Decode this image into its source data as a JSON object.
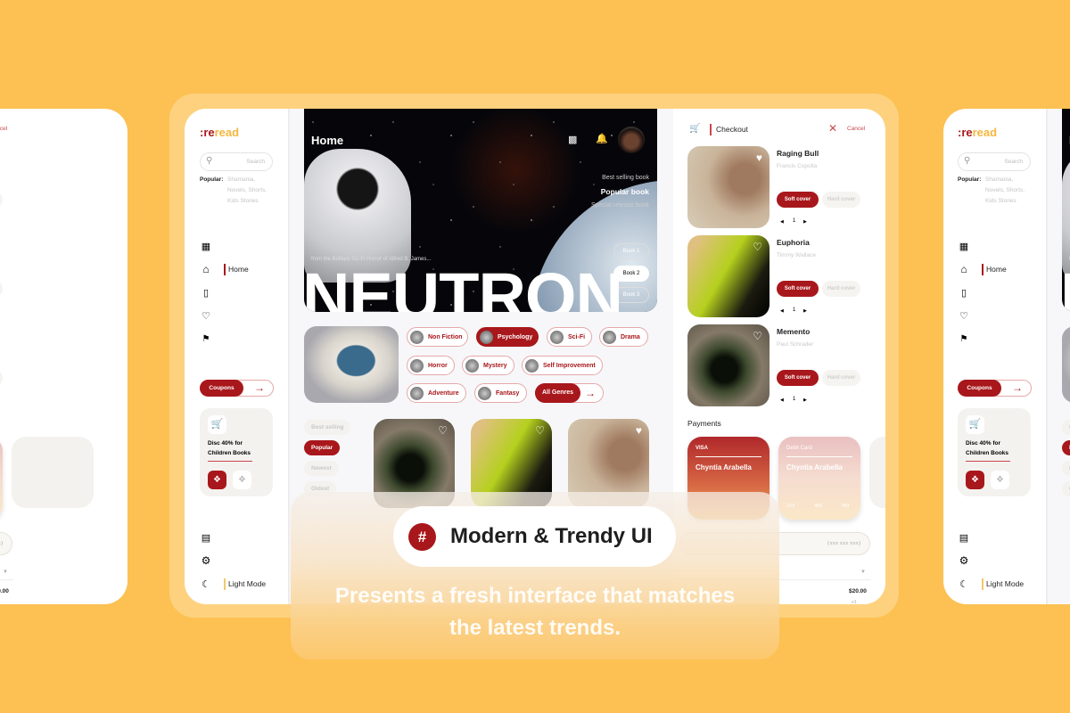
{
  "sidebar": {
    "logo_a": ":re",
    "logo_b": "read",
    "search_placeholder": "Search",
    "popular_label": "Popular:",
    "popular_items": [
      "Shamania,",
      "Novels, Shorts,",
      "Kids Stories"
    ],
    "nav": [
      {
        "icon": "grid-icon"
      },
      {
        "icon": "home-icon",
        "label": "Home",
        "active": true
      },
      {
        "icon": "book-icon"
      },
      {
        "icon": "heart-icon"
      },
      {
        "icon": "bookmark-icon"
      }
    ],
    "coupons_label": "Coupons",
    "promo": {
      "line1": "Disc 40% for",
      "line2": "Children Books"
    },
    "bottom": {
      "mode_label": "Light Mode"
    }
  },
  "hero": {
    "title": "Home",
    "tags": [
      "Best selling book",
      "Popular book",
      "Special release book"
    ],
    "books": [
      "Book 1",
      "Book 2",
      "Book 3"
    ],
    "selected_book": "Book 2",
    "tagline": "from the Brilliant Sci-Fi Horror of Alfred B. James...",
    "book_title": "NEUTRON"
  },
  "genres": {
    "items": [
      "Non Fiction",
      "Psychology",
      "Sci-Fi",
      "Drama",
      "Horror",
      "Mystery",
      "Self Improvement",
      "Adventure",
      "Fantasy"
    ],
    "selected": "Psychology",
    "all_label": "All Genres"
  },
  "sort": {
    "items": [
      "Best selling",
      "Popular",
      "Newest",
      "Oldest"
    ],
    "selected": "Popular"
  },
  "checkout": {
    "title": "Checkout",
    "cancel": "Cancel",
    "items": [
      {
        "title": "Raging Bull",
        "author": "Francis Copolla",
        "qty": "1"
      },
      {
        "title": "Euphoria",
        "author": "Timmy Wallace",
        "qty": "1"
      },
      {
        "title": "Memento",
        "author": "Paul Schrader",
        "qty": "1"
      }
    ],
    "soft_label": "Soft cover",
    "hard_label": "Hard cover",
    "payments_label": "Payments",
    "cards": [
      {
        "type": "VISA",
        "name": "Chyntia Arabella"
      },
      {
        "type": "Debit Card",
        "name": "Chyntia Arabella",
        "number": [
          "123",
          "456",
          "789"
        ]
      }
    ],
    "phone_placeholder": "(xxx xxx xxx)",
    "price": "$20.00",
    "qty_label": "x1",
    "partial_label": "ry"
  },
  "banner": {
    "icon": "#",
    "title": "Modern & Trendy UI",
    "subtitle_1": "Presents a fresh interface that matches",
    "subtitle_2": "the latest trends."
  },
  "colors": {
    "accent": "#a8171b",
    "logo_yellow": "#f4b73f",
    "background": "#fcc152"
  }
}
